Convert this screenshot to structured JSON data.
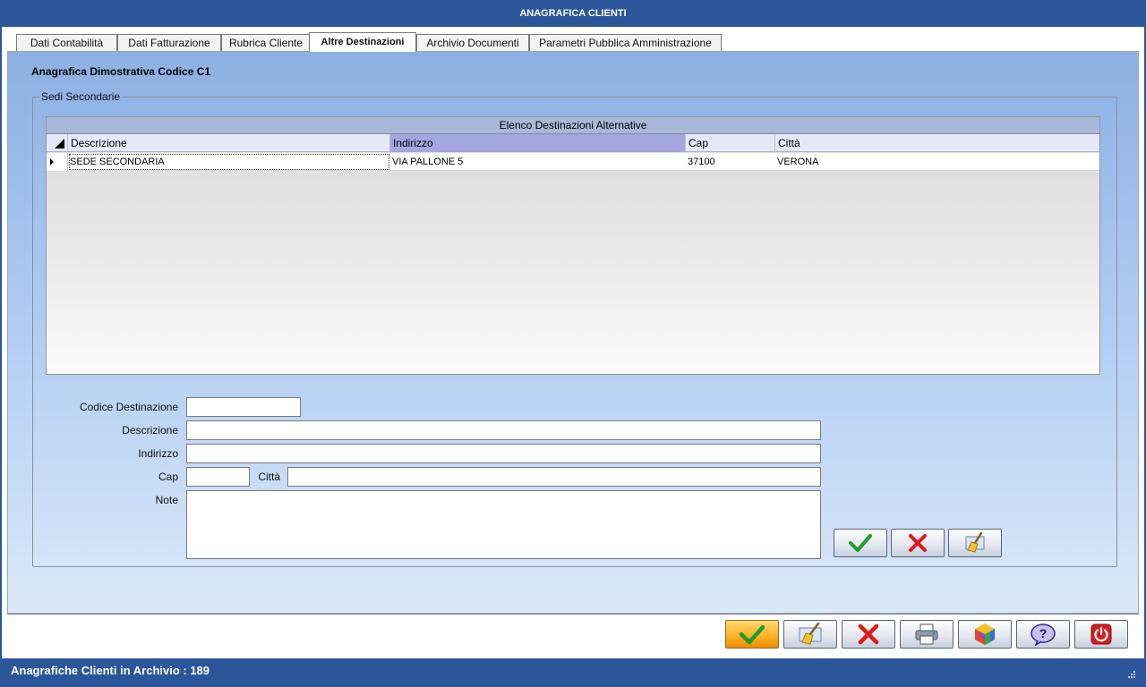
{
  "window": {
    "title": "ANAGRAFICA CLIENTI"
  },
  "tabs": [
    {
      "label": "Dati Contabilità"
    },
    {
      "label": "Dati Fatturazione"
    },
    {
      "label": "Rubrica Cliente"
    },
    {
      "label": "Altre Destinazioni",
      "active": true
    },
    {
      "label": "Archivio Documenti"
    },
    {
      "label": "Parametri Pubblica Amministrazione"
    }
  ],
  "heading": "Anagrafica Dimostrativa Codice C1",
  "group": {
    "legend": "Sedi Secondarie",
    "grid": {
      "caption": "Elenco Destinazioni Alternative",
      "columns": [
        "Descrizione",
        "Indirizzo",
        "Cap",
        "Città"
      ],
      "rows": [
        {
          "descrizione": "SEDE SECONDARIA",
          "indirizzo": "VIA PALLONE 5",
          "cap": "37100",
          "citta": "VERONA"
        }
      ]
    },
    "form": {
      "codice_label": "Codice Destinazione",
      "codice_value": "",
      "descrizione_label": "Descrizione",
      "descrizione_value": "",
      "indirizzo_label": "Indirizzo",
      "indirizzo_value": "",
      "cap_label": "Cap",
      "cap_value": "",
      "citta_label": "Città",
      "citta_value": "",
      "note_label": "Note",
      "note_value": ""
    },
    "form_buttons": {
      "confirm_icon": "check-icon",
      "cancel_icon": "x-icon",
      "clear_icon": "broom-icon"
    }
  },
  "toolbar": {
    "icons": [
      "check-icon",
      "broom-icon",
      "x-icon",
      "printer-icon",
      "cube-icon",
      "help-icon",
      "power-icon"
    ]
  },
  "status": {
    "text": "Anagrafiche Clienti in Archivio :  189"
  },
  "colors": {
    "window_chrome": "#2b579a",
    "panel_top": "#8cb0e3",
    "panel_bottom": "#dbe8f9",
    "grid_caption": "#a9b8d9",
    "sorted_column": "#a4a6e0",
    "check_green": "#1e9e2a",
    "cancel_red": "#e01818",
    "primary_button": "#ffb22c"
  }
}
